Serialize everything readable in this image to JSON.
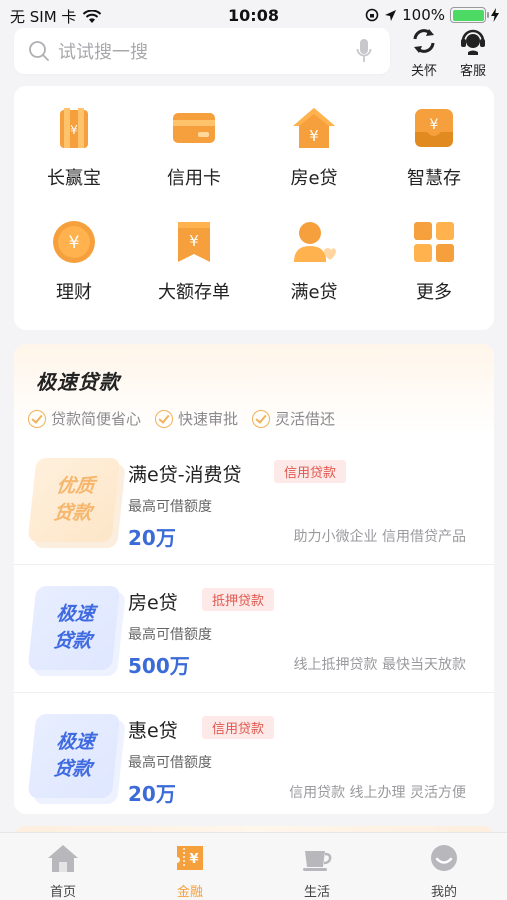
{
  "status_bar": {
    "carrier": "无 SIM 卡",
    "time": "10:08",
    "battery": "100%",
    "battery_level": 1.0
  },
  "header": {
    "search": {
      "placeholder": "试试搜一搜"
    },
    "actions": [
      {
        "label": "关怀",
        "icon": "refresh-care-icon"
      },
      {
        "label": "客服",
        "icon": "customer-service-icon"
      }
    ]
  },
  "quick_menu": {
    "items": [
      {
        "label": "长赢宝",
        "icon": "long-win-icon"
      },
      {
        "label": "信用卡",
        "icon": "credit-card-icon"
      },
      {
        "label": "房e贷",
        "icon": "house-loan-icon"
      },
      {
        "label": "智慧存",
        "icon": "smart-deposit-icon"
      },
      {
        "label": "理财",
        "icon": "wealth-icon"
      },
      {
        "label": "大额存单",
        "icon": "large-deposit-icon"
      },
      {
        "label": "满e贷",
        "icon": "user-loan-icon"
      },
      {
        "label": "更多",
        "icon": "more-grid-icon"
      }
    ]
  },
  "loan_section": {
    "title": "极速贷款",
    "features": [
      "贷款简便省心",
      "快速审批",
      "灵活借还"
    ],
    "products": [
      {
        "badge": [
          "优质",
          "贷款"
        ],
        "badge_color": "orange",
        "name": "满e贷-消费贷",
        "tag": "信用贷款",
        "subtitle": "最高可借额度",
        "amount": "20万",
        "description": "助力小微企业 信用借贷产品"
      },
      {
        "badge": [
          "极速",
          "贷款"
        ],
        "badge_color": "blue",
        "name": "房e贷",
        "tag": "抵押贷款",
        "subtitle": "最高可借额度",
        "amount": "500万",
        "description": "线上抵押贷款 最快当天放款"
      },
      {
        "badge": [
          "极速",
          "贷款"
        ],
        "badge_color": "blue",
        "name": "惠e贷",
        "tag": "信用贷款",
        "subtitle": "最高可借额度",
        "amount": "20万",
        "description": "信用贷款 线上办理 灵活方便"
      }
    ]
  },
  "tab_bar": {
    "active": "金融",
    "tabs": [
      {
        "label": "首页",
        "icon": "home-icon"
      },
      {
        "label": "金融",
        "icon": "finance-icon"
      },
      {
        "label": "生活",
        "icon": "coffee-cup-icon"
      },
      {
        "label": "我的",
        "icon": "profile-icon"
      }
    ]
  },
  "colors": {
    "accent_orange": "#f5a03c",
    "amount_blue": "#3b6bd6",
    "tag_red": "#e0574f"
  }
}
